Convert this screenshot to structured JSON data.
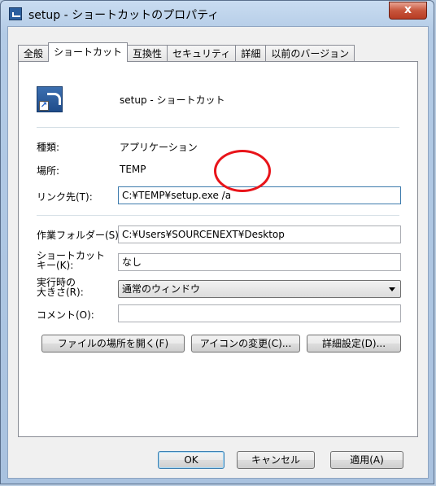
{
  "window": {
    "title": "setup - ショートカットのプロパティ",
    "close_glyph": "x"
  },
  "tabs": [
    {
      "label": "全般"
    },
    {
      "label": "ショートカット"
    },
    {
      "label": "互換性"
    },
    {
      "label": "セキュリティ"
    },
    {
      "label": "詳細"
    },
    {
      "label": "以前のバージョン"
    }
  ],
  "shortcut": {
    "name": "setup - ショートカット",
    "type_label": "種類:",
    "type_value": "アプリケーション",
    "location_label": "場所:",
    "location_value": "TEMP",
    "target_label": "リンク先(T):",
    "target_value": "C:¥TEMP¥setup.exe /a",
    "startin_label": "作業フォルダー(S):",
    "startin_value": "C:¥Users¥SOURCENEXT¥Desktop",
    "hotkey_label_1": "ショートカット",
    "hotkey_label_2": "キー(K):",
    "hotkey_value": "なし",
    "run_label_1": "実行時の",
    "run_label_2": "大きさ(R):",
    "run_value": "通常のウィンドウ",
    "comment_label": "コメント(O):",
    "comment_value": ""
  },
  "buttons": {
    "open_location": "ファイルの場所を開く(F)",
    "change_icon": "アイコンの変更(C)...",
    "advanced": "詳細設定(D)...",
    "ok": "OK",
    "cancel": "キャンセル",
    "apply": "適用(A)"
  },
  "annotation": {
    "color": "#e8141a"
  }
}
